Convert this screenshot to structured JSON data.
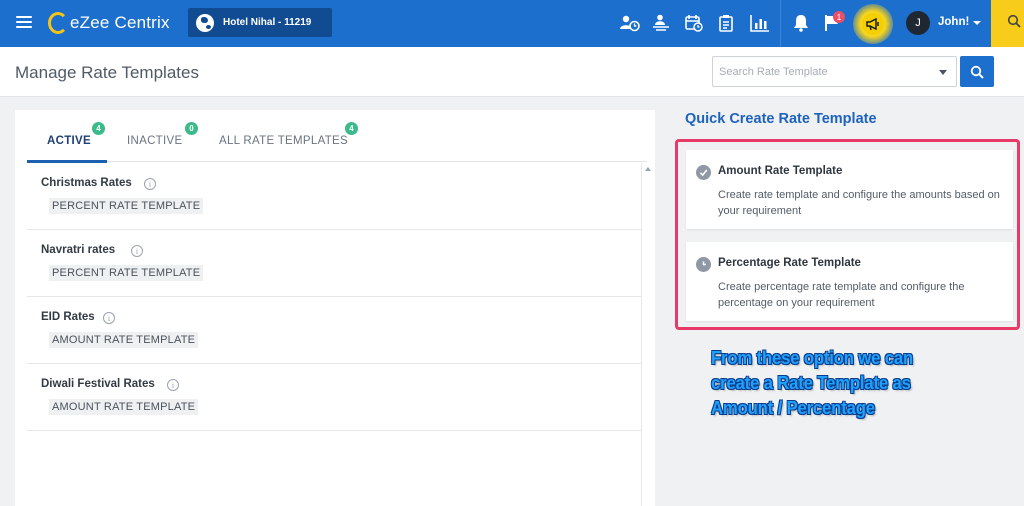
{
  "app": {
    "logo_text": "eZee Centrix",
    "hotel": "Hotel Nihal -  11219",
    "user_initial": "J",
    "user_name": "John!",
    "notification_count": "1"
  },
  "page": {
    "title": "Manage Rate Templates",
    "search_placeholder": "Search Rate Template"
  },
  "tabs": [
    {
      "label": "ACTIVE",
      "count": "4",
      "active": true
    },
    {
      "label": "INACTIVE",
      "count": "0",
      "active": false
    },
    {
      "label": "ALL RATE TEMPLATES",
      "count": "4",
      "active": false
    }
  ],
  "templates": [
    {
      "name": "Christmas Rates",
      "type": "PERCENT RATE TEMPLATE"
    },
    {
      "name": "Navratri rates",
      "type": "PERCENT RATE TEMPLATE"
    },
    {
      "name": "EID Rates",
      "type": "AMOUNT RATE TEMPLATE"
    },
    {
      "name": "Diwali Festival Rates",
      "type": "AMOUNT RATE TEMPLATE"
    }
  ],
  "quick_create": {
    "title": "Quick Create Rate Template",
    "cards": [
      {
        "title": "Amount Rate Template",
        "description": "Create rate template and configure the amounts based on your requirement",
        "icon": "check-circle-icon"
      },
      {
        "title": "Percentage Rate Template",
        "description": "Create percentage rate template and configure the percentage on your requirement",
        "icon": "clock-icon"
      }
    ]
  },
  "annotation": {
    "line1": "From these option we can",
    "line2": "create a Rate Template as",
    "line3": "Amount / Percentage"
  },
  "colors": {
    "topbar": "#1d6fce",
    "highlight": "#e83a67",
    "badge": "#3bba8a",
    "annotation_text": "#1fa2ff"
  }
}
